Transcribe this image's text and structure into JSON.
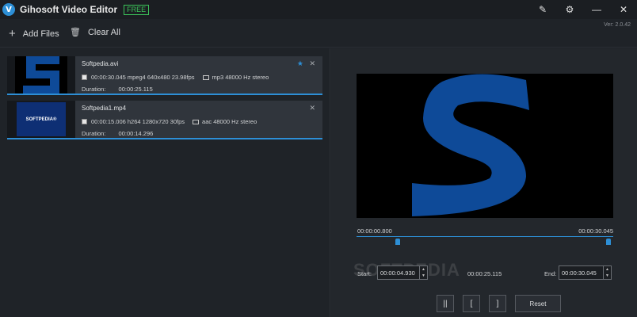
{
  "app": {
    "logo": "V",
    "title": "Gihosoft Video Editor",
    "badge": "FREE",
    "version": "Ver: 2.0.42"
  },
  "window_icons": [
    "feedback-icon",
    "gear-icon",
    "minimize-icon",
    "close-icon"
  ],
  "window_glyphs": {
    "feedback": "✎",
    "settings": "⚙",
    "minimize": "—",
    "close": "✕"
  },
  "toolbar": {
    "add_files": "Add Files",
    "clear_all": "Clear All",
    "add_icon": "+",
    "trash_icon": "🗑"
  },
  "files": [
    {
      "name": "Softpedia.avi",
      "video_info": "00:00:30.045 mpeg4 640x480 23.98fps",
      "audio_info": "mp3 48000 Hz stereo",
      "duration_label": "Duration:",
      "duration": "00:00:25.115",
      "starred": true
    },
    {
      "name": "Softpedia1.mp4",
      "video_info": "00:00:15.006 h264 1280x720 30fps",
      "audio_info": "aac 48000 Hz stereo",
      "duration_label": "Duration:",
      "duration": "00:00:14.296",
      "thumb_text": "SOFTPEDIA®",
      "starred": false
    }
  ],
  "item_glyphs": {
    "star": "★",
    "close": "✕"
  },
  "timeline": {
    "current": "00:00:00.800",
    "total": "00:00:30.045"
  },
  "trim": {
    "start_label": "Start:",
    "start_value": "00:00:04.930",
    "duration_value": "00:00:25.115",
    "end_label": "End:",
    "end_value": "00:00:30.045"
  },
  "spin": {
    "up": "▲",
    "down": "▼"
  },
  "controls": {
    "pause": "||",
    "mark_in": "[",
    "mark_out": "]",
    "reset": "Reset"
  },
  "watermark": "SOFTPEDIA",
  "colors": {
    "accent": "#2d8fd6",
    "badge": "#3cc45a",
    "logo_blue": "#0e4a98"
  }
}
